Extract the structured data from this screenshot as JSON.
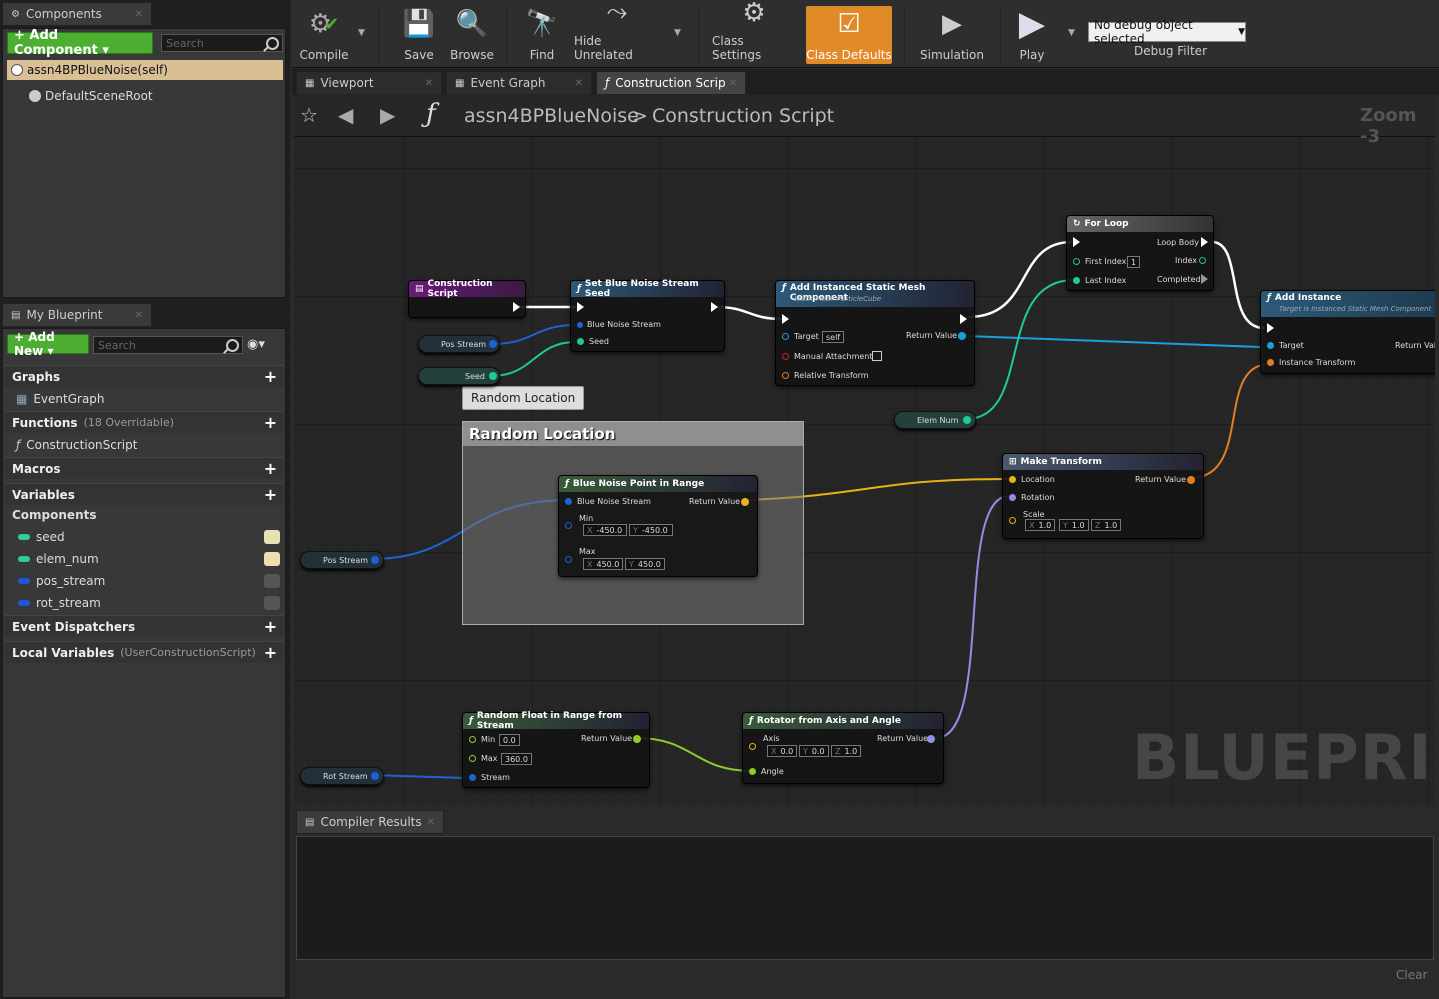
{
  "components_panel": {
    "tab": "Components",
    "add_label": "+ Add Component ▾",
    "search_placeholder": "Search",
    "self_item": "assn4BPBlueNoise(self)",
    "root_item": "DefaultSceneRoot"
  },
  "my_blueprint": {
    "tab": "My Blueprint",
    "add_label": "+ Add New ▾",
    "search_placeholder": "Search",
    "graphs_label": "Graphs",
    "event_graph": "EventGraph",
    "functions_label": "Functions",
    "functions_sub": "(18 Overridable)",
    "construction_script": "ConstructionScript",
    "macros_label": "Macros",
    "variables_label": "Variables",
    "components_label": "Components",
    "variables": [
      {
        "name": "seed",
        "color": "#2ecf96"
      },
      {
        "name": "elem_num",
        "color": "#2ecf96"
      },
      {
        "name": "pos_stream",
        "color": "#1a58d8"
      },
      {
        "name": "rot_stream",
        "color": "#1a58d8"
      }
    ],
    "dispatchers_label": "Event Dispatchers",
    "locals_label": "Local Variables",
    "locals_sub": "(UserConstructionScript)"
  },
  "toolbar": {
    "compile": "Compile",
    "save": "Save",
    "browse": "Browse",
    "find": "Find",
    "hide_unrelated": "Hide Unrelated",
    "class_settings": "Class Settings",
    "class_defaults": "Class Defaults",
    "simulation": "Simulation",
    "play": "Play",
    "debug_select": "No debug object selected",
    "debug_filter": "Debug Filter"
  },
  "tabs": [
    {
      "label": "Viewport"
    },
    {
      "label": "Event Graph"
    },
    {
      "label": "Construction Scrip"
    }
  ],
  "breadcrumb": {
    "blueprint": "assn4BPBlueNoise",
    "sep": ">",
    "graph": "Construction Script",
    "zoom": "Zoom -3"
  },
  "graph": {
    "construction_node": "Construction Script",
    "set_seed": {
      "title": "Set Blue Noise Stream Seed",
      "pin1": "Blue Noise Stream",
      "pin2": "Seed"
    },
    "add_ism": {
      "title": "Add Instanced Static Mesh Component",
      "subtitle": "Static Mesh ParticleCube",
      "target": "Target",
      "self": "self",
      "manual": "Manual Attachment",
      "relative": "Relative Transform",
      "ret": "Return Value"
    },
    "for_loop": {
      "title": "For Loop",
      "loop_body": "Loop Body",
      "first_index": "First Index",
      "first_val": "1",
      "last_index": "Last Index",
      "index": "Index",
      "completed": "Completed"
    },
    "add_instance": {
      "title": "Add Instance",
      "subtitle": "Target is Instanced Static Mesh Component",
      "target": "Target",
      "transform": "Instance Transform",
      "ret": "Return Valu"
    },
    "getters": {
      "pos1": "Pos Stream",
      "seed": "Seed",
      "elem": "Elem Num",
      "pos2": "Pos Stream",
      "rot": "Rot Stream"
    },
    "comment_tooltip": "Random Location",
    "comment_title": "Random Location",
    "bnp": {
      "title": "Blue Noise Point in Range",
      "stream": "Blue Noise Stream",
      "ret": "Return Value",
      "min": "Min",
      "max": "Max",
      "minx": "-450.0",
      "miny": "-450.0",
      "maxx": "450.0",
      "maxy": "450.0",
      "xl": "X",
      "yl": "Y"
    },
    "make_transform": {
      "title": "Make Transform",
      "location": "Location",
      "rotation": "Rotation",
      "scale": "Scale",
      "ret": "Return Value",
      "sx": "1.0",
      "sy": "1.0",
      "sz": "1.0",
      "xl": "X",
      "yl": "Y",
      "zl": "Z"
    },
    "rand_float": {
      "title": "Random Float in Range from Stream",
      "min": "Min",
      "minv": "0.0",
      "max": "Max",
      "maxv": "360.0",
      "stream": "Stream",
      "ret": "Return Value"
    },
    "rotator": {
      "title": "Rotator from Axis and Angle",
      "axis": "Axis",
      "ax": "0.0",
      "ay": "0.0",
      "az": "1.0",
      "angle": "Angle",
      "ret": "Return Value",
      "xl": "X",
      "yl": "Y",
      "zl": "Z"
    },
    "watermark": "BLUEPRINT"
  },
  "compiler": {
    "tab": "Compiler Results",
    "clear": "Clear"
  }
}
